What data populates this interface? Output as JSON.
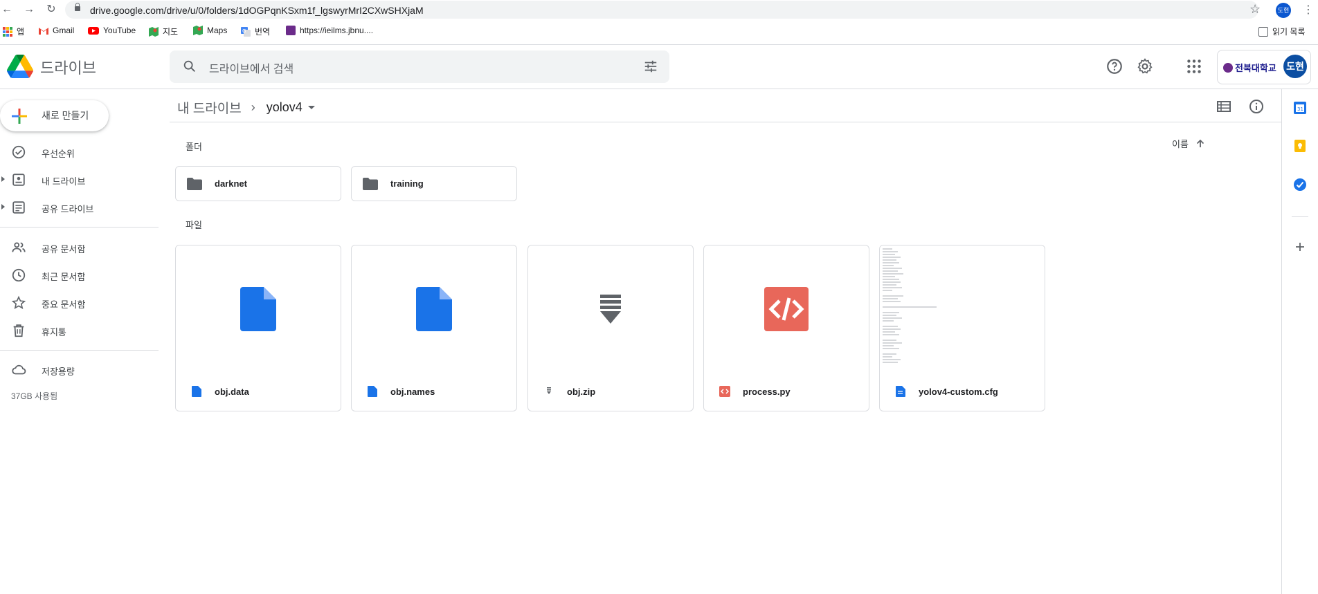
{
  "browser": {
    "url": "drive.google.com/drive/u/0/folders/1dOGPqnKSxm1f_lgswyrMrI2CXwSHXjaM",
    "profile_initials": "도현"
  },
  "bookmarks": {
    "items": [
      {
        "label": "앱",
        "icon": "apps-grid-icon"
      },
      {
        "label": "Gmail",
        "icon": "gmail-icon"
      },
      {
        "label": "YouTube",
        "icon": "youtube-icon"
      },
      {
        "label": "지도",
        "icon": "maps-icon"
      },
      {
        "label": "Maps",
        "icon": "maps-icon"
      },
      {
        "label": "번역",
        "icon": "translate-icon"
      },
      {
        "label": "https://ieilms.jbnu....",
        "icon": "site-icon"
      }
    ],
    "reading_list": "읽기 목록"
  },
  "header": {
    "app_name": "드라이브",
    "search_placeholder": "드라이브에서 검색",
    "account_org": "전북대학교",
    "account_initials": "도현"
  },
  "sidebar": {
    "new_button": "새로 만들기",
    "items": [
      {
        "label": "우선순위",
        "icon": "priority-check-icon"
      },
      {
        "label": "내 드라이브",
        "icon": "my-drive-icon"
      },
      {
        "label": "공유 드라이브",
        "icon": "shared-drive-icon"
      },
      {
        "label": "공유 문서함",
        "icon": "people-icon"
      },
      {
        "label": "최근 문서함",
        "icon": "clock-icon"
      },
      {
        "label": "중요 문서함",
        "icon": "star-icon"
      },
      {
        "label": "휴지통",
        "icon": "trash-icon"
      },
      {
        "label": "저장용량",
        "icon": "cloud-icon"
      }
    ],
    "storage_used": "37GB 사용됨"
  },
  "main": {
    "breadcrumb_root": "내 드라이브",
    "breadcrumb_current": "yolov4",
    "folders_label": "폴더",
    "files_label": "파일",
    "sort_label": "이름",
    "folders": [
      {
        "name": "darknet"
      },
      {
        "name": "training"
      }
    ],
    "files": [
      {
        "name": "obj.data",
        "type": "document"
      },
      {
        "name": "obj.names",
        "type": "document"
      },
      {
        "name": "obj.zip",
        "type": "archive"
      },
      {
        "name": "process.py",
        "type": "code"
      },
      {
        "name": "yolov4-custom.cfg",
        "type": "text-preview"
      }
    ]
  },
  "colors": {
    "doc_blue": "#1a73e8",
    "code_red": "#e8675a",
    "zip_gray": "#5f6368",
    "folder_gray": "#5f6368",
    "accent_blue": "#0b57d0"
  }
}
